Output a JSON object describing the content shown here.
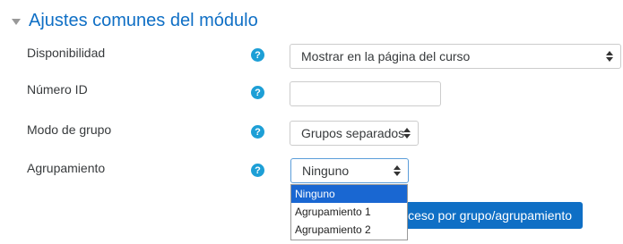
{
  "section": {
    "title": "Ajustes comunes del módulo"
  },
  "fields": {
    "availability": {
      "label": "Disponibilidad",
      "value": "Mostrar en la página del curso"
    },
    "idnumber": {
      "label": "Número ID",
      "value": ""
    },
    "groupmode": {
      "label": "Modo de grupo",
      "value": "Grupos separados"
    },
    "grouping": {
      "label": "Agrupamiento",
      "value": "Ninguno",
      "options": [
        "Ninguno",
        "Agrupamiento 1",
        "Agrupamiento 2"
      ]
    }
  },
  "help_glyph": "?",
  "button": {
    "label": "acceso por grupo/agrupamiento"
  },
  "colors": {
    "link": "#0f6fc5",
    "help": "#1d9fd6",
    "highlight": "#1967d2"
  }
}
